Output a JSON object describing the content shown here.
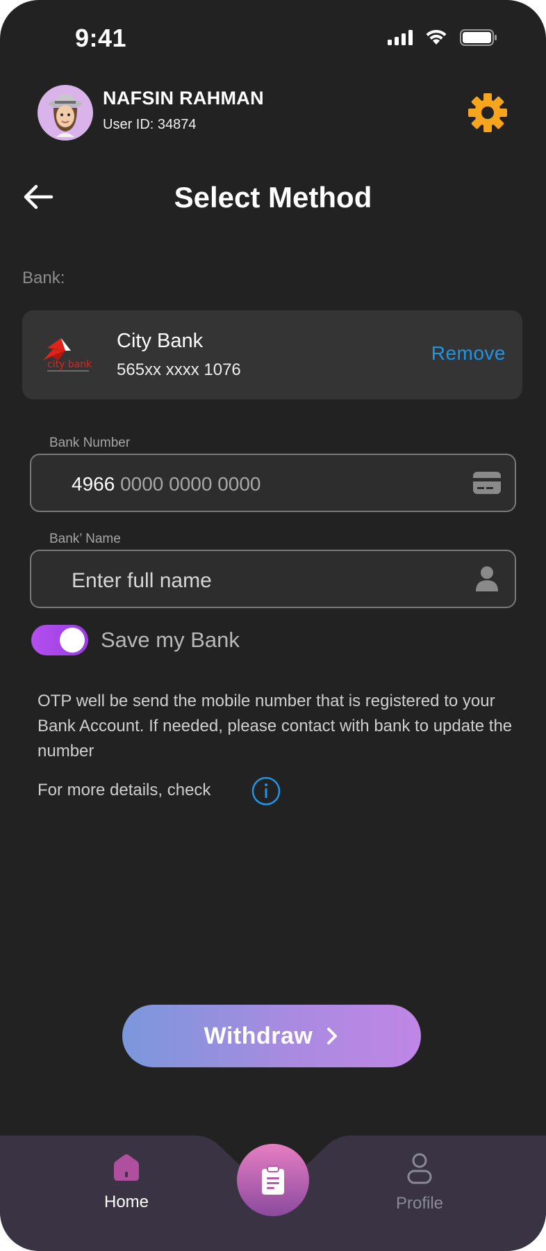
{
  "status_bar": {
    "time": "9:41"
  },
  "header": {
    "user_name": "NAFSIN RAHMAN",
    "user_id": "User ID: 34874",
    "settings_color": "#f7a51c"
  },
  "page": {
    "title": "Select Method",
    "bank_section_label": "Bank:"
  },
  "selected_bank": {
    "name": "City Bank",
    "account": "565xx xxxx 1076",
    "logo_text": "city bank",
    "remove_label": "Remove"
  },
  "form": {
    "bank_number": {
      "label": "Bank Number",
      "value_entered": "4966",
      "value_placeholder": " 0000 0000 0000"
    },
    "bank_name": {
      "label": "Bank’ Name",
      "placeholder": "Enter full name"
    },
    "save_toggle": {
      "label": "Save my Bank",
      "on": true
    }
  },
  "info": {
    "otp_notice": "OTP well be send the mobile number that is registered to your Bank Account. If needed, please contact with bank to update the number",
    "details_text": "For more details, check"
  },
  "actions": {
    "withdraw_label": "Withdraw"
  },
  "bottom_nav": {
    "home_label": "Home",
    "profile_label": "Profile",
    "accent": "#b04f9e"
  },
  "colors": {
    "background": "#222223",
    "card": "#343434",
    "link": "#1e96e6",
    "toggle": "#b44ff0"
  }
}
